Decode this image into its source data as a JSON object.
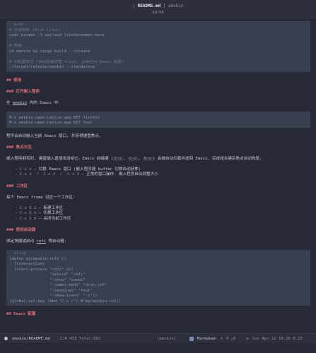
{
  "titlebar": {
    "file": "README.md",
    "separator": "|",
    "project": "emskin",
    "position": "60/00"
  },
  "install_code": [
    {
      "text": "  bash",
      "kind": "comment"
    },
    {
      "text": "# 安装依赖 (Arch Linux)",
      "kind": "comment"
    },
    {
      "text": "sudo pacman -S wayland libxkbcommon mesa",
      "kind": "code"
    },
    {
      "text": "",
      "kind": "code"
    },
    {
      "text": "# 构建",
      "kind": "comment"
    },
    {
      "text": "cd emskin && cargo build --release",
      "kind": "code"
    },
    {
      "text": "",
      "kind": "code"
    },
    {
      "text": "# 带配置体验 (自动加载内置 elisp, 无需任何 Emacs 配置)",
      "kind": "comment"
    },
    {
      "text": "./target/release/emskin --standalone",
      "kind": "code"
    }
  ],
  "heading_usage": "## 使用",
  "heading_open_app": "### 打开嵌入程序",
  "para_in_emskin_prefix": "在 ",
  "para_in_emskin_link": "emskin",
  "para_in_emskin_suffix": " 内的 Emacs 中:",
  "mx_code": [
    "M-x emskin-open-native-app RET firefox",
    "M-x emskin-open-native-app RET foot"
  ],
  "para_auto_embed": "程序会自动嵌入当前 Emacs 窗口, 并获得键盘焦点。",
  "heading_focus": "### 焦点交互",
  "para_focus": {
    "p1": "嵌入程序拥有时, 键盘输入直接发送给它。Emacs 前缀键 (",
    "k1": "C-x",
    "p2": ", ",
    "k2": "C-c",
    "p3": ", ",
    "k3": "M-x",
    "p4": ") 会被自动拦截并送回 Emacs, 完成组合键后焦点自动恢复。"
  },
  "focus_list": [
    {
      "bullet": "- ",
      "keys": "C-x o",
      "desc": " — 切换 Emacs 窗口 (嵌入程序随 buffer 切换自动获焦)"
    },
    {
      "bullet": "- ",
      "keys": "C-x 1  /  C-x 2  /  C-x 3",
      "desc": " — 正常的窗口操作, 嵌入程序自动调整大小"
    }
  ],
  "heading_workspace": "### 工作区",
  "para_workspace": "每个 Emacs frame 对应一个工作区:",
  "workspace_list": [
    {
      "bullet": "- ",
      "keys": "C-x 5 2",
      "desc": " — 新建工作区"
    },
    {
      "bullet": "- ",
      "keys": "C-x 5 o",
      "desc": " — 切换工作区"
    },
    {
      "bullet": "- ",
      "keys": "C-x 5 0",
      "desc": " — 关闭当前工作区"
    }
  ],
  "heading_launcher": "### 使用启动器",
  "para_launcher_prefix": "绑定快捷键启动 ",
  "para_launcher_link": "rofi",
  "para_launcher_suffix": " 等启动器:",
  "elisp_code": [
    "  elisp",
    "(defun my/emskin-rofi ()",
    "  (interactive)",
    "  (start-process \"rofi\" nil",
    "                 \"setsid\" \"rofi\"",
    "                 \"-show\" \"combi\"",
    "                 \"-combi-modi\" \"drun,ssh\"",
    "                 \"-terminal\" \"foot\"",
    "                 \"-show-icons\" \"-i\"))",
    "(global-set-key (kbd \"C-c r\") #'my/emskin-rofi)"
  ],
  "heading_emacs_config": "## Emacs 配置",
  "statusbar": {
    "path": "emskin/README.md",
    "cursor": "CJK:453 Total:602",
    "mode_tag": "[emskin]",
    "major_mode": "Markdown",
    "diag": "0 △0",
    "clock": "Sun Apr 12 16:26 0.23"
  }
}
